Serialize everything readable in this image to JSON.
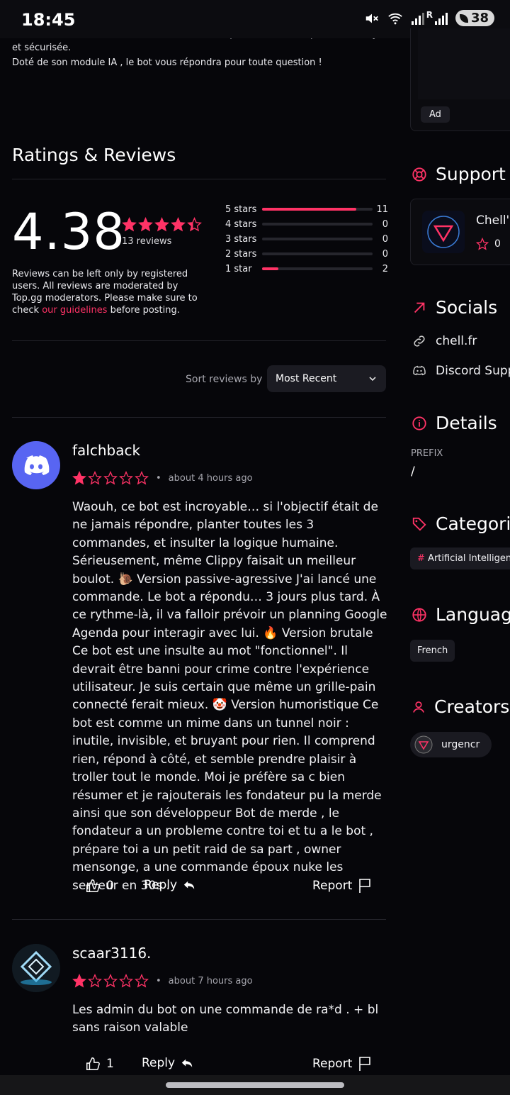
{
  "status_bar": {
    "time": "18:45",
    "battery": "38",
    "signal_label": "R"
  },
  "description": {
    "line_cut": "administrateur ou membre, Chell rend votre expérience Discord plus fluide, stylée",
    "line1": "et sécurisée.",
    "line2": "Doté de son module IA , le bot vous répondra pour toute question !"
  },
  "ratings": {
    "title": "Ratings & Reviews",
    "average": "4.38",
    "average_stars": 4.38,
    "count_label": "13 reviews",
    "breakdown": [
      {
        "label": "5 stars",
        "count": "11",
        "fraction": 0.85
      },
      {
        "label": "4 stars",
        "count": "0",
        "fraction": 0
      },
      {
        "label": "3 stars",
        "count": "0",
        "fraction": 0
      },
      {
        "label": "2 stars",
        "count": "0",
        "fraction": 0
      },
      {
        "label": "1 star",
        "count": "2",
        "fraction": 0.15
      }
    ],
    "note_before": "Reviews can be left only by registered users. All reviews are moderated by Top.gg moderators. Please make sure to check ",
    "note_link": "our guidelines",
    "note_after": " before posting."
  },
  "sort": {
    "label": "Sort reviews by",
    "selected": "Most Recent"
  },
  "reviews": [
    {
      "username": "falchback",
      "rating": 1,
      "time": "about 4 hours ago",
      "text": "Waouh, ce bot est incroyable… si l'objectif était de ne jamais répondre, planter toutes les 3 commandes, et insulter la logique humaine. Sérieusement, même Clippy faisait un meilleur boulot. 🐌 Version passive-agressive J'ai lancé une commande. Le bot a répondu… 3 jours plus tard. À ce rythme-là, il va falloir prévoir un planning Google Agenda pour interagir avec lui. 🔥 Version brutale Ce bot est une insulte au mot \"fonctionnel\". Il devrait être banni pour crime contre l'expérience utilisateur. Je suis certain que même un grille-pain connecté ferait mieux. 🤡 Version humoristique Ce bot est comme un mime dans un tunnel noir : inutile, invisible, et bruyant pour rien. Il comprend rien, répond à côté, et semble prendre plaisir à troller tout le monde. Moi je préfère sa c bien résumer et je rajouterais les fondateur pu la merde ainsi que son développeur Bot de merde , le fondateur a un probleme contre toi et tu a le bot , prépare toi a un petit raid de sa part , owner mensonge, a une commande époux nuke les serveur en 30s .",
      "likes": "0",
      "reply": "Reply",
      "report": "Report"
    },
    {
      "username": "scaar3116.",
      "rating": 1,
      "time": "about 7 hours ago",
      "text": "Les admin du bot on une commande de ra*d . + bl sans raison valable",
      "likes": "1",
      "reply": "Reply",
      "report": "Report"
    }
  ],
  "sidebar": {
    "ad_label": "Ad",
    "support_title": "Support S",
    "support_server_name": "Chell's",
    "support_server_rating": "0",
    "socials_title": "Socials",
    "socials": [
      {
        "label": "chell.fr",
        "icon": "link-icon"
      },
      {
        "label": "Discord Supp",
        "icon": "discord-icon"
      }
    ],
    "details_title": "Details",
    "prefix_label": "PREFIX",
    "prefix_value": "/",
    "categories_title": "Categori",
    "category_hash": "#",
    "category": "Artificial Intelligen",
    "languages_title": "Language",
    "language": "French",
    "creators_title": "Creators",
    "creator": "urgencr"
  },
  "colors": {
    "accent": "#ff3366",
    "background": "#06060a",
    "discord": "#5865f2"
  }
}
